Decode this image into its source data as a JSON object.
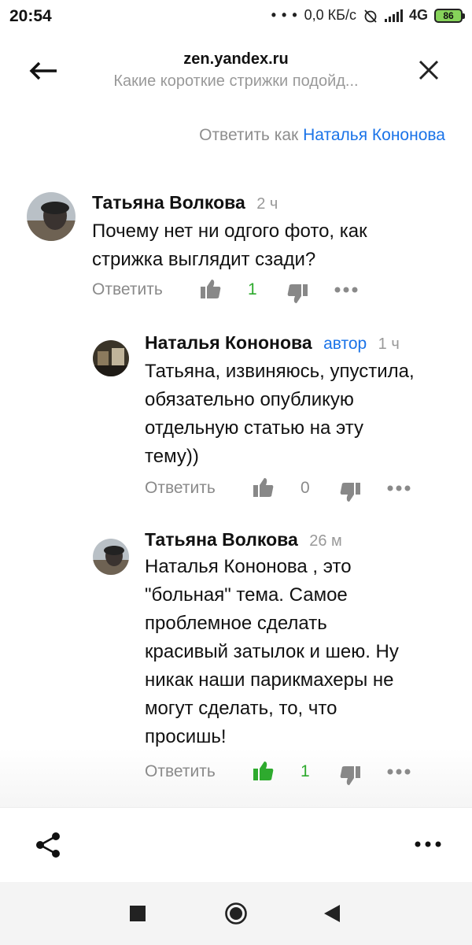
{
  "status_bar": {
    "time": "20:54",
    "dots": "• • •",
    "speed": "0,0 КБ/с",
    "network": "4G",
    "battery": "86"
  },
  "header": {
    "domain": "zen.yandex.ru",
    "subtitle": "Какие короткие стрижки подойд...",
    "back_icon": "arrow-left-icon",
    "close_icon": "close-icon"
  },
  "reply_as": {
    "prefix": "Ответить как",
    "name": "Наталья Кононова"
  },
  "comments": [
    {
      "author": "Татьяна Волкова",
      "badge": "",
      "time": "2 ч",
      "text_lines": [
        "Почему нет ни одгого фото, как",
        "стрижка выглядит сзади?"
      ],
      "reply_label": "Ответить",
      "likes": "1",
      "liked": true
    },
    {
      "author": "Наталья Кононова",
      "badge": "автор",
      "time": "1 ч",
      "text_lines": [
        "Татьяна, извиняюсь, упустила,",
        "обязательно опубликую",
        "отдельную статью на эту",
        "тему))"
      ],
      "reply_label": "Ответить",
      "likes": "0",
      "liked": false
    },
    {
      "author": "Татьяна Волкова",
      "badge": "",
      "time": "26 м",
      "text_lines": [
        "Наталья Кононова , это",
        "\"больная\" тема. Самое",
        "проблемное сделать",
        "красивый затылок и шею. Ну",
        "никак наши парикмахеры не",
        "могут сделать, то, что",
        "просишь!"
      ],
      "reply_label": "Ответить",
      "likes": "1",
      "liked": true
    }
  ],
  "colors": {
    "accent": "#1a73e8",
    "like_green": "#2eaa2e",
    "muted": "#8a8a8a"
  }
}
